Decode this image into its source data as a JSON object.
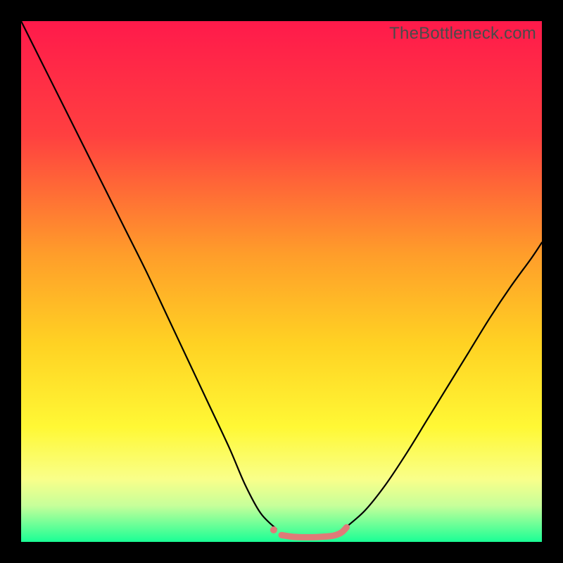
{
  "watermark": "TheBottleneck.com",
  "chart_data": {
    "type": "line",
    "title": "",
    "xlabel": "",
    "ylabel": "",
    "xlim": [
      0,
      100
    ],
    "ylim": [
      0,
      100
    ],
    "background_gradient": {
      "stops": [
        {
          "offset": 0,
          "color": "#ff1a4b"
        },
        {
          "offset": 22,
          "color": "#ff4040"
        },
        {
          "offset": 45,
          "color": "#ff9e2a"
        },
        {
          "offset": 62,
          "color": "#ffd223"
        },
        {
          "offset": 78,
          "color": "#fff835"
        },
        {
          "offset": 88,
          "color": "#f9ff8a"
        },
        {
          "offset": 93,
          "color": "#c7ff9a"
        },
        {
          "offset": 100,
          "color": "#1aff95"
        }
      ]
    },
    "series": [
      {
        "name": "left-curve",
        "color": "#000000",
        "x": [
          0,
          4,
          8,
          12,
          16,
          20,
          24,
          28,
          32,
          36,
          40,
          43,
          46,
          49
        ],
        "y": [
          100,
          92,
          84,
          76,
          68,
          60,
          52,
          43.5,
          35,
          26.5,
          18,
          11,
          5.5,
          2.5
        ]
      },
      {
        "name": "right-curve",
        "color": "#000000",
        "x": [
          62,
          66,
          70,
          74,
          78,
          82,
          86,
          90,
          94,
          98,
          100
        ],
        "y": [
          2.5,
          6,
          11,
          17,
          23.5,
          30,
          36.5,
          43,
          49,
          54.5,
          57.5
        ]
      },
      {
        "name": "valley-marker",
        "color": "#e07a78",
        "stroke_width": 9,
        "points": [
          {
            "x": 48.5,
            "y": 2.3,
            "type": "dot",
            "r": 5
          },
          {
            "x": 50.0,
            "y": 1.3
          },
          {
            "x": 52.0,
            "y": 1.0
          },
          {
            "x": 54.0,
            "y": 0.9
          },
          {
            "x": 56.0,
            "y": 0.9
          },
          {
            "x": 58.0,
            "y": 1.0
          },
          {
            "x": 60.0,
            "y": 1.2
          },
          {
            "x": 61.5,
            "y": 1.8
          },
          {
            "x": 62.5,
            "y": 2.8
          }
        ]
      }
    ]
  }
}
